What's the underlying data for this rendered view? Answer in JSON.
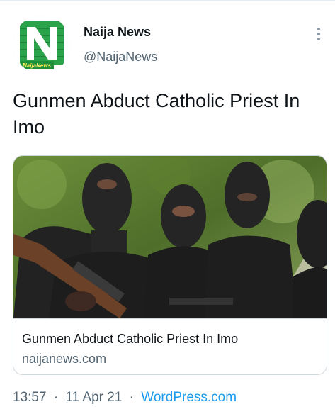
{
  "author": {
    "name": "Naija News",
    "handle": "@NaijaNews",
    "avatar_text": "NaijaNews"
  },
  "tweet": {
    "text": "Gunmen Abduct Catholic Priest In Imo"
  },
  "card": {
    "title": "Gunmen Abduct Catholic Priest In Imo",
    "domain": "naijanews.com"
  },
  "meta": {
    "time": "13:57",
    "separator": "·",
    "date": "11 Apr 21",
    "source": "WordPress.com"
  },
  "icons": {
    "more": "more-vertical-icon",
    "avatar": "naija-news-logo"
  },
  "colors": {
    "brand_green": "#1f8f3a",
    "link_blue": "#1d9bf0",
    "secondary_text": "#536471"
  }
}
